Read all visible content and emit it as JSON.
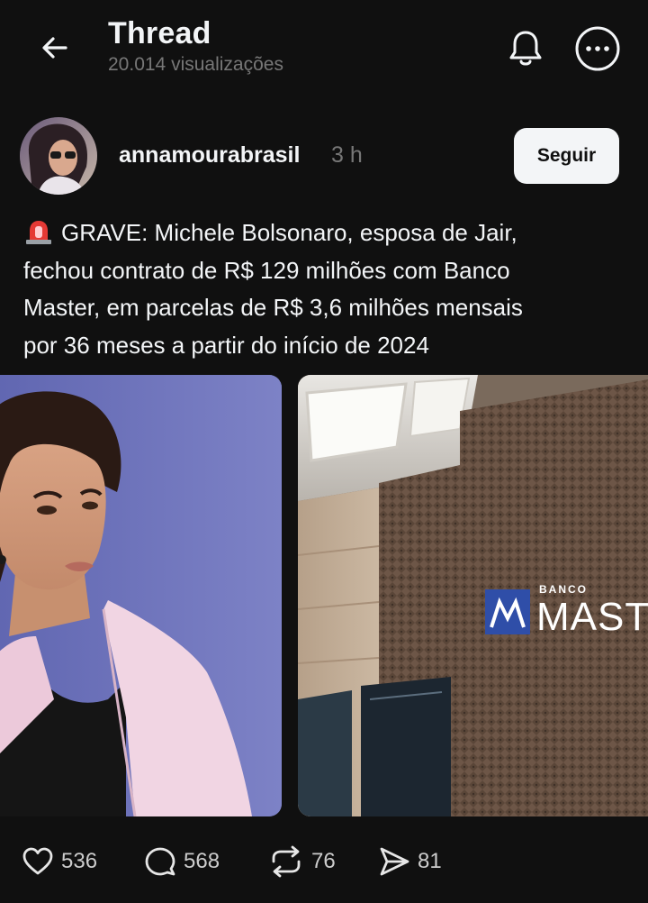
{
  "header": {
    "title": "Thread",
    "views": "20.014 visualizações"
  },
  "post": {
    "username": "annamourabrasil",
    "time": "3 h",
    "follow_label": "Seguir",
    "text_lines": [
      "GRAVE: Michele Bolsonaro, esposa de Jair,",
      "fechou contrato de R$ 129 milhões com Banco",
      "Master, em parcelas de R$ 3,6 milhões mensais",
      "por 36 meses a partir do início de 2024"
    ],
    "media": [
      {
        "name": "photo-woman-portrait"
      },
      {
        "name": "photo-banco-master-building",
        "sign_top": "BANCO",
        "sign_main": "MAST"
      }
    ]
  },
  "actions": {
    "likes": "536",
    "replies": "568",
    "reposts": "76",
    "shares": "81"
  },
  "icons": {
    "back": "arrow-left-icon",
    "bell": "bell-icon",
    "more": "more-icon",
    "siren": "siren-emoji-icon",
    "like": "heart-icon",
    "reply": "comment-icon",
    "repost": "repost-icon",
    "share": "share-icon"
  },
  "colors": {
    "background": "#101010",
    "text": "#f3f5f7",
    "muted": "#777777",
    "button_bg": "#f3f5f7"
  }
}
